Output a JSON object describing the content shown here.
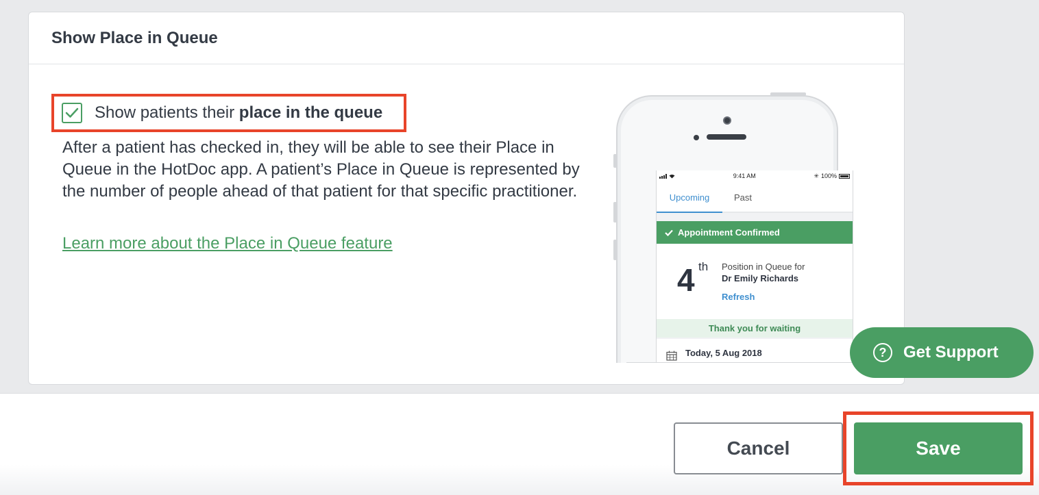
{
  "card": {
    "title": "Show Place in Queue",
    "option": {
      "checked": true,
      "label_prefix": "Show patients their ",
      "label_bold": "place in the queue"
    },
    "description": "After a patient has checked in, they will be able to see their Place in Queue in the HotDoc app. A patient’s Place in Queue is represented by the number of people ahead of that patient for that specific practitioner.",
    "learn_more_link": "Learn more about the Place in Queue feature"
  },
  "phone_preview": {
    "status": {
      "time": "9:41 AM",
      "battery": "100%"
    },
    "tabs": [
      "Upcoming",
      "Past"
    ],
    "active_tab": "Upcoming",
    "confirmed_banner": "Appointment Confirmed",
    "queue_number": "4",
    "queue_suffix": "th",
    "position_label": "Position in Queue for",
    "doctor_name": "Dr Emily Richards",
    "refresh_label": "Refresh",
    "thanks_text": "Thank you for waiting",
    "date_text": "Today, 5 Aug 2018"
  },
  "support": {
    "label": "Get Support",
    "icon": "question-circle-icon"
  },
  "footer": {
    "cancel_label": "Cancel",
    "save_label": "Save"
  },
  "colors": {
    "accent_green": "#4a9e63",
    "highlight_red": "#e8442a",
    "link_blue": "#3f8fcf"
  }
}
